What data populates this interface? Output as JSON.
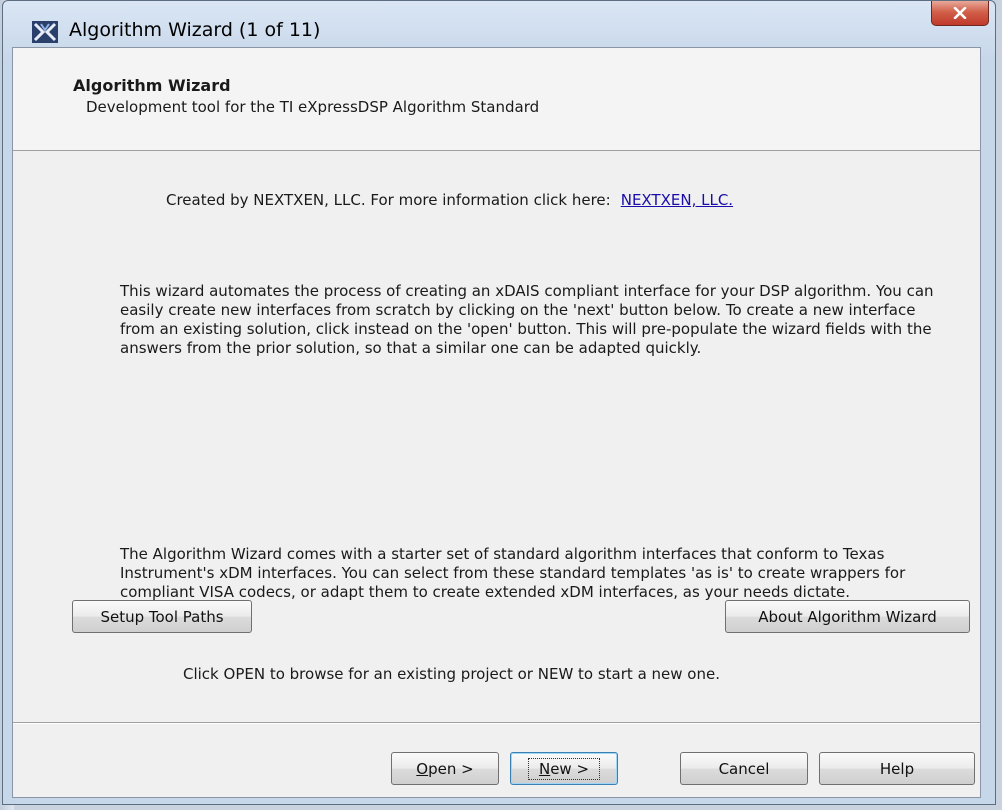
{
  "window": {
    "title": "Algorithm Wizard (1 of 11)",
    "close_icon": "close-x-icon",
    "app_icon": "nextxen-logo-icon"
  },
  "header": {
    "title": "Algorithm Wizard",
    "subtitle": "Development tool for the TI eXpressDSP Algorithm Standard"
  },
  "main": {
    "created_text": "Created by NEXTXEN, LLC.  For more information click here:",
    "created_link": "NEXTXEN, LLC.",
    "paragraph1": "This wizard automates the process of creating an xDAIS compliant interface for your DSP algorithm.  You can easily create new interfaces from scratch by clicking on the 'next' button below.  To create a new interface from an existing solution, click instead on the 'open' button.  This will pre-populate the wizard fields with the answers from the prior solution, so that a similar one can be adapted quickly.",
    "paragraph2": "The Algorithm Wizard comes with a starter set of standard algorithm interfaces that conform to Texas Instrument's xDM interfaces.  You can select from these standard templates 'as is' to create wrappers for compliant VISA codecs, or adapt them to create extended xDM interfaces, as your needs dictate.",
    "setup_button": "Setup Tool Paths",
    "about_button": "About Algorithm Wizard",
    "hint": "Click OPEN to browse for an existing project or NEW to start a new one."
  },
  "footer": {
    "open_mnemonic": "O",
    "open_rest": "pen >",
    "new_mnemonic": "N",
    "new_rest": "ew >",
    "cancel": "Cancel",
    "help": "Help"
  },
  "colors": {
    "link": "#1a0dab",
    "close_button": "#c0392b",
    "window_frame": "#c7d7ea"
  }
}
